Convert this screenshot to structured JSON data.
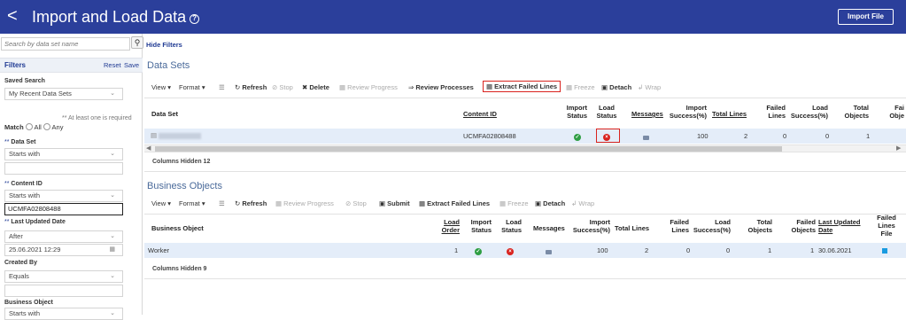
{
  "header": {
    "back": "<",
    "title": "Import and Load Data",
    "help": "?",
    "import_button": "Import File"
  },
  "left": {
    "search_placeholder": "Search by data set name",
    "search_icon": "search-icon",
    "filters_title": "Filters",
    "reset": "Reset",
    "save": "Save",
    "saved_search_label": "Saved Search",
    "saved_search_value": "My Recent Data Sets",
    "required_hint": "** At least one is required",
    "match_label": "Match",
    "match_all": "All",
    "match_any": "Any",
    "data_set_label": "Data Set",
    "data_set_req": "**",
    "data_set_op": "Starts with",
    "content_id_label": "Content ID",
    "content_id_req": "**",
    "content_id_op": "Starts with",
    "content_id_value": "UCMFA02808488",
    "last_updated_label": "Last Updated Date",
    "last_updated_req": "**",
    "last_updated_op": "After",
    "last_updated_value": "25.06.2021 12:29",
    "created_by_label": "Created By",
    "created_by_op": "Equals",
    "business_object_label": "Business Object",
    "business_object_op": "Starts with"
  },
  "main": {
    "hide_filters": "Hide Filters",
    "data_sets": {
      "title": "Data Sets",
      "toolbar": {
        "view": "View ▾",
        "format": "Format ▾",
        "refresh": "Refresh",
        "stop": "Stop",
        "delete": "Delete",
        "review_progress": "Review Progress",
        "review_processes": "Review Processes",
        "extract_failed": "Extract Failed Lines",
        "freeze": "Freeze",
        "detach": "Detach",
        "wrap": "Wrap"
      },
      "columns": {
        "data_set": "Data Set",
        "content_id": "Content ID",
        "import_status": [
          "Import",
          "Status"
        ],
        "load_status": [
          "Load",
          "Status"
        ],
        "messages": "Messages",
        "import_success": [
          "Import",
          "Success(%)"
        ],
        "total_lines": "Total Lines",
        "failed_lines": [
          "Failed",
          "Lines"
        ],
        "load_success": [
          "Load",
          "Success(%)"
        ],
        "total_objects": [
          "Total",
          "Objects"
        ],
        "failed_objects": [
          "Fai",
          "Obje"
        ]
      },
      "row": {
        "data_set": "",
        "content_id": "UCMFA02808488",
        "import_success": "100",
        "total_lines": "2",
        "failed_lines": "0",
        "load_success": "0",
        "total_objects": "1"
      },
      "columns_hidden": "Columns Hidden  12"
    },
    "business_objects": {
      "title": "Business Objects",
      "toolbar": {
        "view": "View ▾",
        "format": "Format ▾",
        "refresh": "Refresh",
        "review_progress": "Review Progress",
        "stop": "Stop",
        "submit": "Submit",
        "extract_failed": "Extract Failed Lines",
        "freeze": "Freeze",
        "detach": "Detach",
        "wrap": "Wrap"
      },
      "columns": {
        "business_object": "Business Object",
        "load_order": [
          "Load",
          "Order"
        ],
        "import_status": [
          "Import",
          "Status"
        ],
        "load_status": [
          "Load",
          "Status"
        ],
        "messages": "Messages",
        "import_success": [
          "Import",
          "Success(%)"
        ],
        "total_lines": "Total Lines",
        "failed_lines": [
          "Failed",
          "Lines"
        ],
        "load_success": [
          "Load",
          "Success(%)"
        ],
        "total_objects": [
          "Total",
          "Objects"
        ],
        "failed_objects": [
          "Failed",
          "Objects"
        ],
        "last_updated": [
          "Last Updated",
          "Date"
        ],
        "failed_lines_file": [
          "Failed",
          "Lines",
          "File"
        ]
      },
      "row": {
        "business_object": "Worker",
        "load_order": "1",
        "import_success": "100",
        "total_lines": "2",
        "failed_lines": "0",
        "load_success": "0",
        "total_objects": "1",
        "failed_objects": "1",
        "last_updated": "30.06.2021"
      },
      "columns_hidden": "Columns Hidden  9"
    }
  },
  "colors": {
    "header": "#2b3f9b",
    "success": "#2f9e44",
    "error": "#d9231e",
    "highlight": "#d9231e",
    "row": "#e4edf9"
  }
}
